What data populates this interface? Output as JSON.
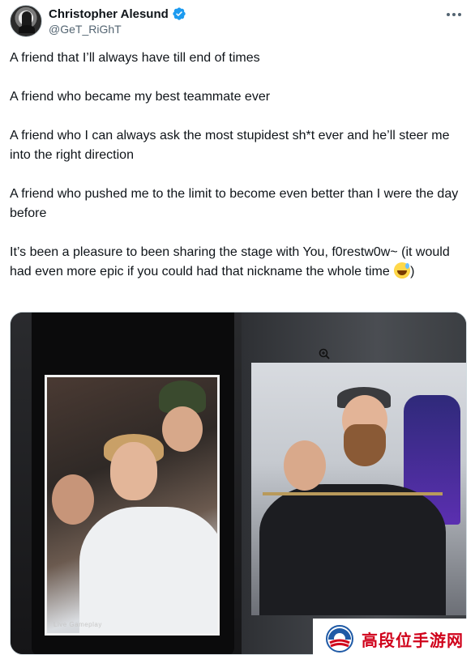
{
  "author": {
    "display_name": "Christopher Alesund",
    "handle": "@GeT_RiGhT",
    "verified": true
  },
  "tweet": {
    "paragraphs": [
      "A friend that I’ll always have till end of times",
      "A friend who became my best teammate ever",
      "A friend who I can always ask the most stupidest sh*t ever and he’ll steer me into the right direction",
      "A friend who pushed me to the limit to become even better than I were the day before"
    ],
    "last_paragraph": "It’s been a pleasure to been sharing the stage with You, f0restw0w~ (it would had even more epic if you could had that nickname the whole time ",
    "last_paragraph_tail": ")",
    "emoji": "grinning-face-with-sweat-icon"
  },
  "media": {
    "photo_left_watermark": "Live Gameplay"
  },
  "watermark": {
    "text": "高段位手游网",
    "color": "#d0021b"
  },
  "colors": {
    "text": "#0f1419",
    "secondary": "#536471",
    "verified_blue": "#1d9bf0"
  }
}
